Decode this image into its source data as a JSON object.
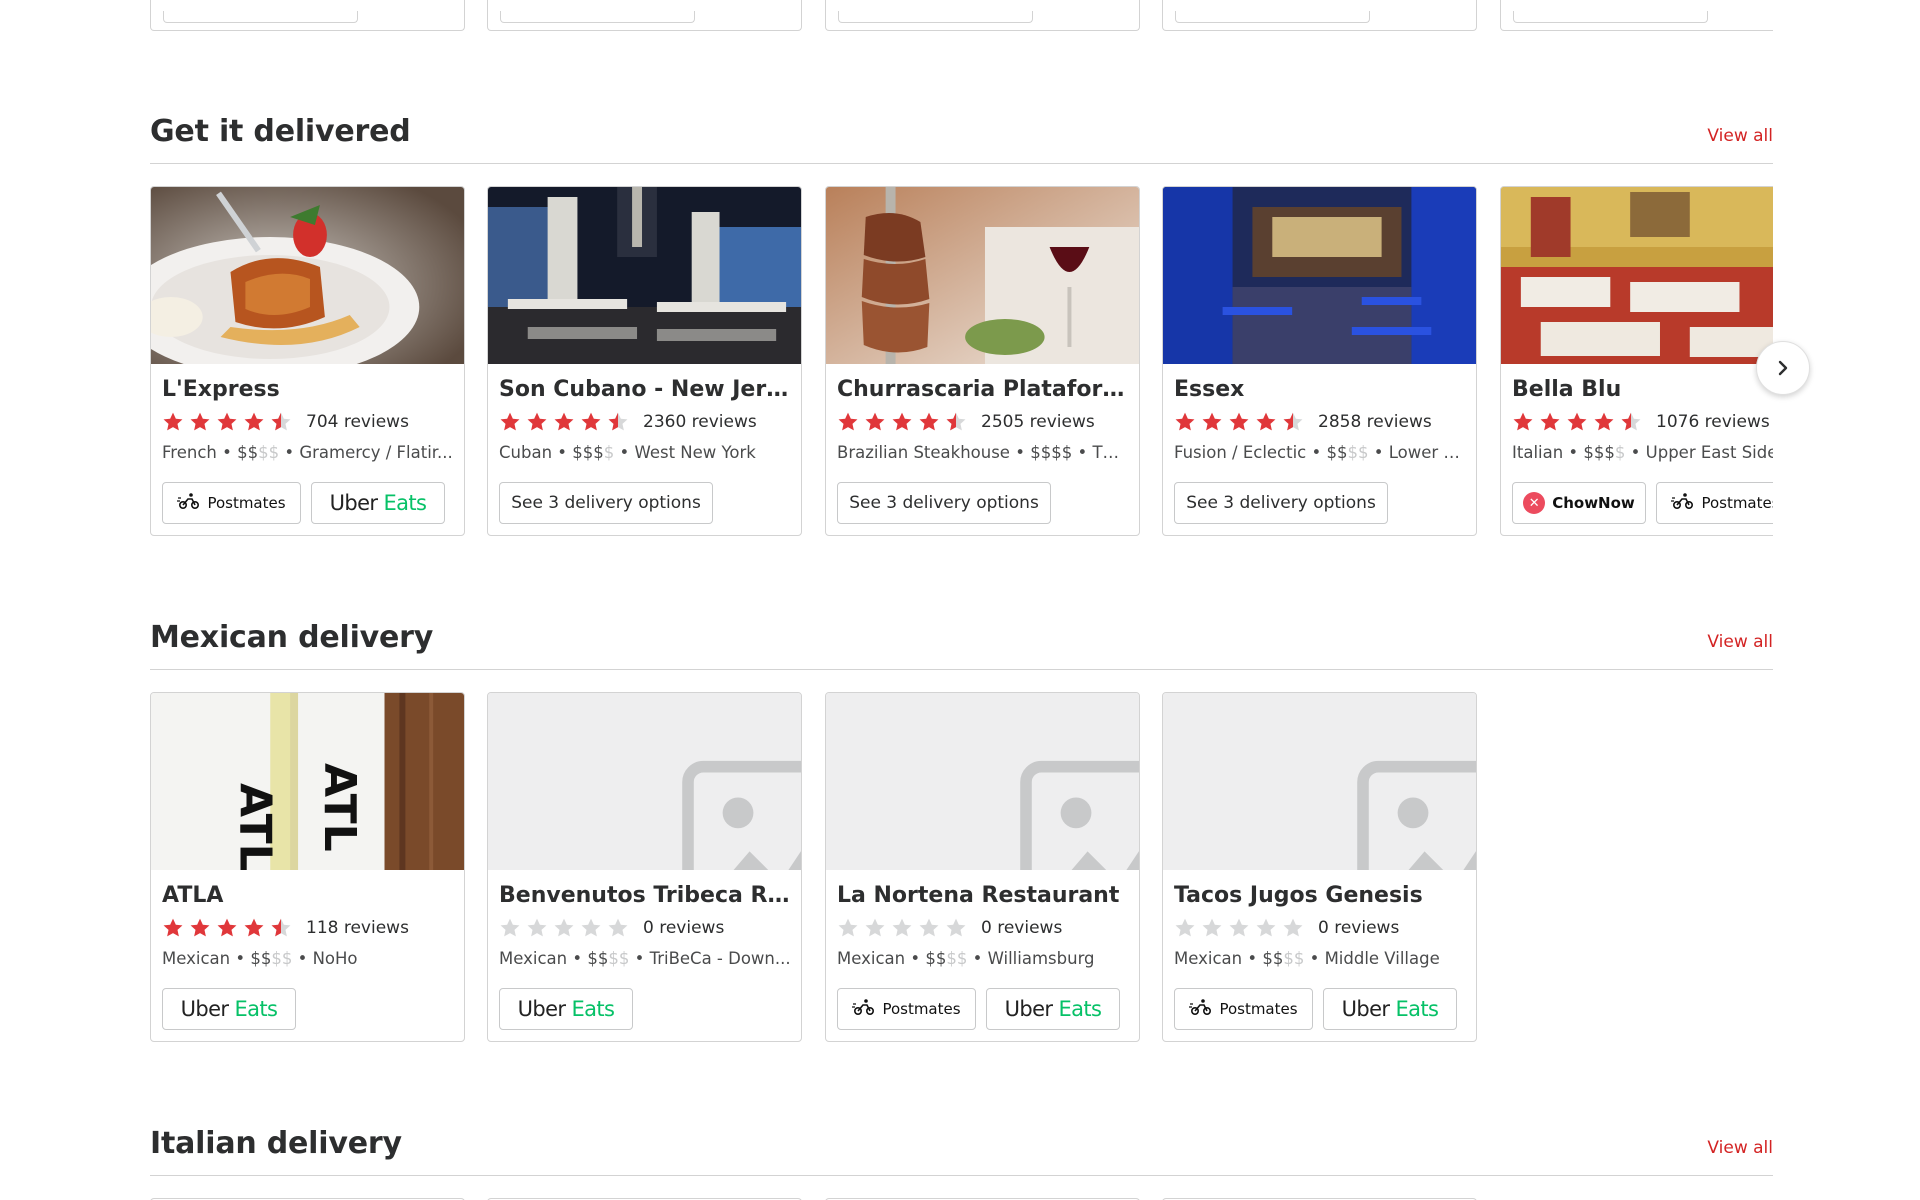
{
  "sections": [
    {
      "title": "Get it delivered",
      "view_all": "View all",
      "cards": [
        {
          "name": "L'Express",
          "rating": 4.5,
          "reviews": "704 reviews",
          "cuisine": "French",
          "price": "$$",
          "price_dim": "$$",
          "area": "Gramercy / Flatir...",
          "providers": [
            "Postmates",
            "Uber Eats"
          ]
        },
        {
          "name": "Son Cubano - New Jersey",
          "rating": 4.5,
          "reviews": "2360 reviews",
          "cuisine": "Cuban",
          "price": "$$$",
          "price_dim": "$",
          "area": "West New York",
          "options": "See 3 delivery options"
        },
        {
          "name": "Churrascaria Plataforma B...",
          "rating": 4.5,
          "reviews": "2505 reviews",
          "cuisine": "Brazilian Steakhouse",
          "price": "$$$$",
          "price_dim": "",
          "area": "The...",
          "options": "See 3 delivery options"
        },
        {
          "name": "Essex",
          "rating": 4.5,
          "reviews": "2858 reviews",
          "cuisine": "Fusion / Eclectic",
          "price": "$$",
          "price_dim": "$$",
          "area": "Lower E...",
          "options": "See 3 delivery options"
        },
        {
          "name": "Bella Blu",
          "rating": 4.5,
          "reviews": "1076 reviews",
          "cuisine": "Italian",
          "price": "$$$",
          "price_dim": "$",
          "area": "Upper East Side",
          "providers": [
            "ChowNow",
            "Postmates"
          ]
        }
      ]
    },
    {
      "title": "Mexican delivery",
      "view_all": "View all",
      "cards": [
        {
          "name": "ATLA",
          "rating": 4.5,
          "reviews": "118 reviews",
          "cuisine": "Mexican",
          "price": "$$",
          "price_dim": "$$",
          "area": "NoHo",
          "providers": [
            "Uber Eats"
          ]
        },
        {
          "name": "Benvenutos Tribeca Resta...",
          "rating": 0,
          "reviews": "0 reviews",
          "cuisine": "Mexican",
          "price": "$$",
          "price_dim": "$$",
          "area": "TriBeCa - Down...",
          "providers": [
            "Uber Eats"
          ]
        },
        {
          "name": "La Nortena Restaurant",
          "rating": 0,
          "reviews": "0 reviews",
          "cuisine": "Mexican",
          "price": "$$",
          "price_dim": "$$",
          "area": "Williamsburg",
          "providers": [
            "Postmates",
            "Uber Eats"
          ]
        },
        {
          "name": "Tacos Jugos Genesis",
          "rating": 0,
          "reviews": "0 reviews",
          "cuisine": "Mexican",
          "price": "$$",
          "price_dim": "$$",
          "area": "Middle Village",
          "providers": [
            "Postmates",
            "Uber Eats"
          ]
        }
      ]
    },
    {
      "title": "Italian delivery",
      "view_all": "View all"
    }
  ],
  "providers": {
    "postmates": "Postmates",
    "uber": "Uber",
    "eats": "Eats",
    "chownow": "ChowNow"
  },
  "icons": {
    "next": "chevron-right-icon",
    "placeholder": "image-placeholder-icon",
    "star": "star-icon"
  },
  "colors": {
    "accent": "#d32323",
    "star": "#e0373a",
    "star_empty": "#d7d8d9",
    "uber_eats_green": "#06c167",
    "chownow": "#ec4b5e"
  }
}
